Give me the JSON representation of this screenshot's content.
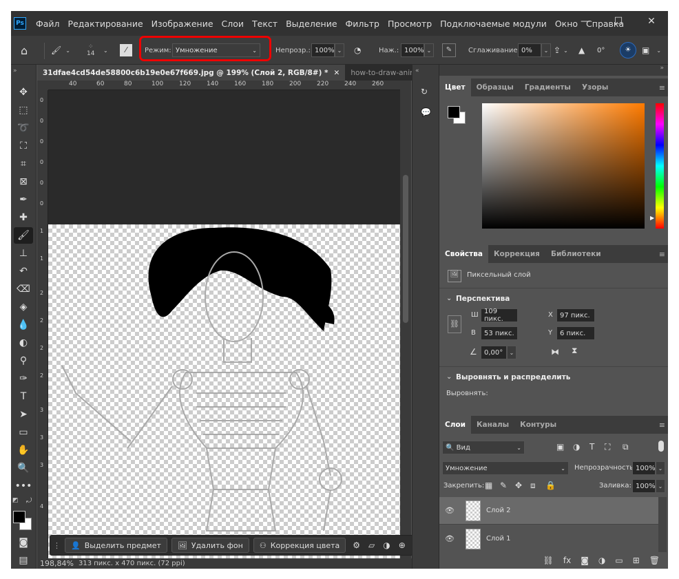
{
  "app": {
    "logo": "Ps"
  },
  "menu": [
    "Файл",
    "Редактирование",
    "Изображение",
    "Слои",
    "Текст",
    "Выделение",
    "Фильтр",
    "Просмотр",
    "Подключаемые модули",
    "Окно",
    "Справка"
  ],
  "options": {
    "brush_size": "14",
    "mode_label": "Режим:",
    "mode_value": "Умножение",
    "opacity_label": "Непрозр.:",
    "opacity_value": "100%",
    "pressure_label": "Наж.:",
    "pressure_value": "100%",
    "smoothing_label": "Сглаживание:",
    "smoothing_value": "0%",
    "angle_value": "0°"
  },
  "doc": {
    "tabs": [
      "31dfae4cd54de58800c6b19e0e67f669.jpg @ 199% (Слой 2, RGB/8#) *",
      "how-to-draw-anin"
    ],
    "ruler_top": [
      "40",
      "60",
      "80",
      "100",
      "120",
      "140",
      "160",
      "180",
      "200",
      "220",
      "240",
      "260"
    ],
    "ruler_left": [
      "0",
      "0",
      "0",
      "0",
      "0",
      "0",
      "1",
      "1",
      "2",
      "2",
      "2",
      "2",
      "3",
      "3",
      "3",
      "4"
    ],
    "zoom": "198,84%",
    "size_info": "313 пикс. x 470 пикс. (72 ppi)"
  },
  "context_bar": {
    "select_subject": "Выделить предмет",
    "remove_bg": "Удалить фон",
    "color_correction": "Коррекция цвета"
  },
  "color_panel": {
    "tabs": [
      "Цвет",
      "Образцы",
      "Градиенты",
      "Узоры"
    ],
    "hue_accent": "#ff7b00"
  },
  "properties": {
    "tabs": [
      "Свойства",
      "Коррекция",
      "Библиотеки"
    ],
    "layer_kind": "Пиксельный слой",
    "section_perspective": "Перспектива",
    "w_label": "Ш",
    "w_value": "109 пикс.",
    "x_label": "X",
    "x_value": "97 пикс.",
    "h_label": "В",
    "h_value": "53 пикс.",
    "y_label": "Y",
    "y_value": "6 пикс.",
    "angle_value": "0,00°",
    "section_align": "Выровнять и распределить",
    "align_label": "Выровнять:"
  },
  "layers": {
    "tabs": [
      "Слои",
      "Каналы",
      "Контуры"
    ],
    "filter_label": "Вид",
    "blend_mode": "Умножение",
    "opacity_label": "Непрозрачность:",
    "opacity_value": "100%",
    "lock_label": "Закрепить:",
    "fill_label": "Заливка:",
    "fill_value": "100%",
    "items": [
      {
        "name": "Слой 2",
        "selected": true
      },
      {
        "name": "Слой 1",
        "selected": false
      }
    ]
  }
}
